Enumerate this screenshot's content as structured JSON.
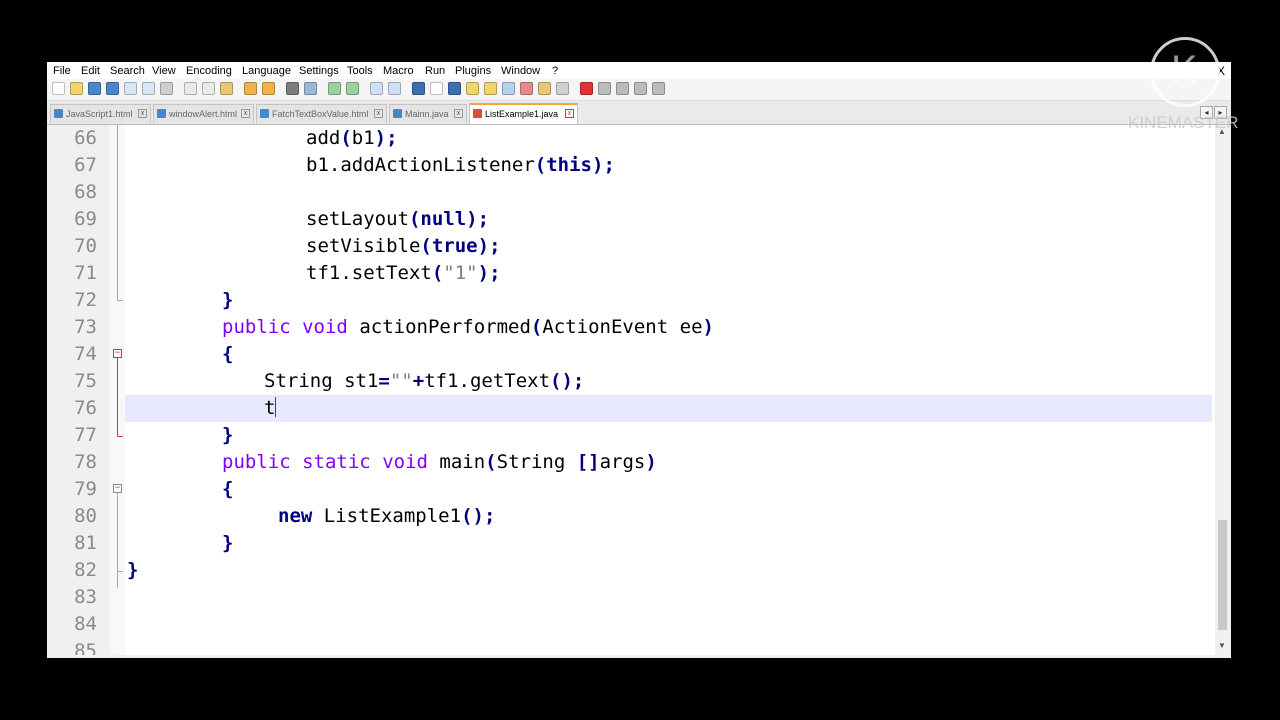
{
  "menu": [
    "File",
    "Edit",
    "Search",
    "View",
    "Encoding",
    "Language",
    "Settings",
    "Tools",
    "Macro",
    "Run",
    "Plugins",
    "Window",
    "?"
  ],
  "window_close": "X",
  "tabs": [
    {
      "label": "JavaScript1.html",
      "active": false
    },
    {
      "label": "windowAlert.html",
      "active": false
    },
    {
      "label": "FatchTextBoxValue.html",
      "active": false
    },
    {
      "label": "Mainn.java",
      "active": false
    },
    {
      "label": "ListExample1.java",
      "active": true
    }
  ],
  "tab_close_glyph": "x",
  "tab_scroll": {
    "left": "◂",
    "right": "▸"
  },
  "lines": [
    {
      "num": "66",
      "indent": 18
    },
    {
      "num": "67",
      "indent": 18
    },
    {
      "num": "68",
      "indent": 0
    },
    {
      "num": "69",
      "indent": 18
    },
    {
      "num": "70",
      "indent": 18
    },
    {
      "num": "71",
      "indent": 18
    },
    {
      "num": "72",
      "indent": 10
    },
    {
      "num": "73",
      "indent": 10
    },
    {
      "num": "74",
      "indent": 10
    },
    {
      "num": "75",
      "indent": 13
    },
    {
      "num": "76",
      "indent": 13
    },
    {
      "num": "77",
      "indent": 10
    },
    {
      "num": "78",
      "indent": 10
    },
    {
      "num": "79",
      "indent": 10
    },
    {
      "num": "80",
      "indent": 14
    },
    {
      "num": "81",
      "indent": 10
    },
    {
      "num": "82",
      "indent": 0
    },
    {
      "num": "83",
      "indent": 0
    },
    {
      "num": "84",
      "indent": 0
    },
    {
      "num": "85",
      "indent": 0
    }
  ],
  "code": {
    "l66": [
      "add",
      "(",
      "b1",
      ")",
      ";"
    ],
    "l67": [
      "b1.addActionListener",
      "(",
      "this",
      ")",
      ";"
    ],
    "l69": [
      "setLayout",
      "(",
      "null",
      ")",
      ";"
    ],
    "l70": [
      "setVisible",
      "(",
      "true",
      ")",
      ";"
    ],
    "l71": [
      "tf1.setText",
      "(",
      "\"1\"",
      ")",
      ";"
    ],
    "l72": [
      "}"
    ],
    "l73": [
      "public",
      "void",
      "actionPerformed",
      "(",
      "ActionEvent ee",
      ")"
    ],
    "l74": [
      "{"
    ],
    "l75": [
      "String st1",
      "=",
      "\"\"",
      "+",
      "tf1.getText",
      "()",
      ";"
    ],
    "l76": [
      "t"
    ],
    "l77": [
      "}"
    ],
    "l78": [
      "public",
      "static",
      "void",
      "main",
      "(",
      "String ",
      "[]",
      "args",
      ")"
    ],
    "l79": [
      "{"
    ],
    "l80": [
      "new",
      "ListExample1",
      "()",
      ";"
    ],
    "l81": [
      "}"
    ],
    "l82": [
      "}"
    ]
  },
  "current_line": "76",
  "fold_glyph": "−",
  "watermark_text": "KINEMASTER",
  "colors": {
    "keyword": "#8000ff",
    "bold_keyword": "#000080",
    "current_line": "#e8e8ff",
    "active_tab_accent": "#f7a33a"
  }
}
